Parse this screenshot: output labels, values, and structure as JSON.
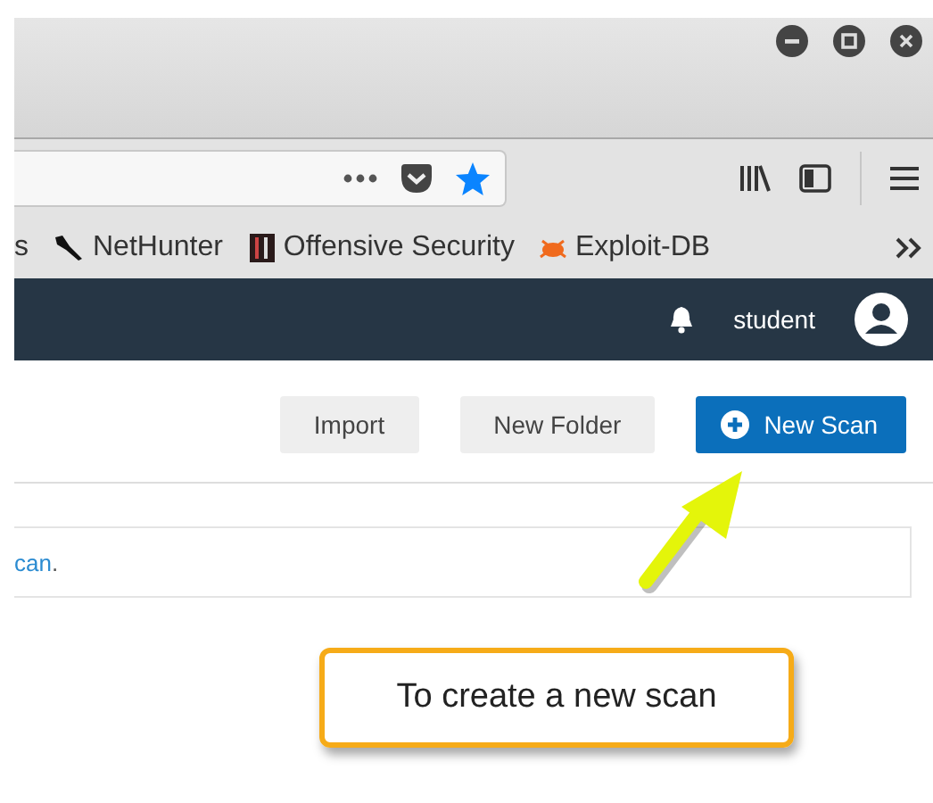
{
  "bookmarks": [
    {
      "label": "s"
    },
    {
      "label": "NetHunter"
    },
    {
      "label": "Offensive Security"
    },
    {
      "label": "Exploit-DB"
    }
  ],
  "navbar": {
    "user": "student"
  },
  "buttons": [
    {
      "label": "Import",
      "kind": "secondary"
    },
    {
      "label": "New Folder",
      "kind": "secondary"
    },
    {
      "label": "New Scan",
      "kind": "primary"
    }
  ],
  "notice": {
    "link": "can",
    "suffix": "."
  },
  "callout": {
    "text": "To create a new scan"
  }
}
